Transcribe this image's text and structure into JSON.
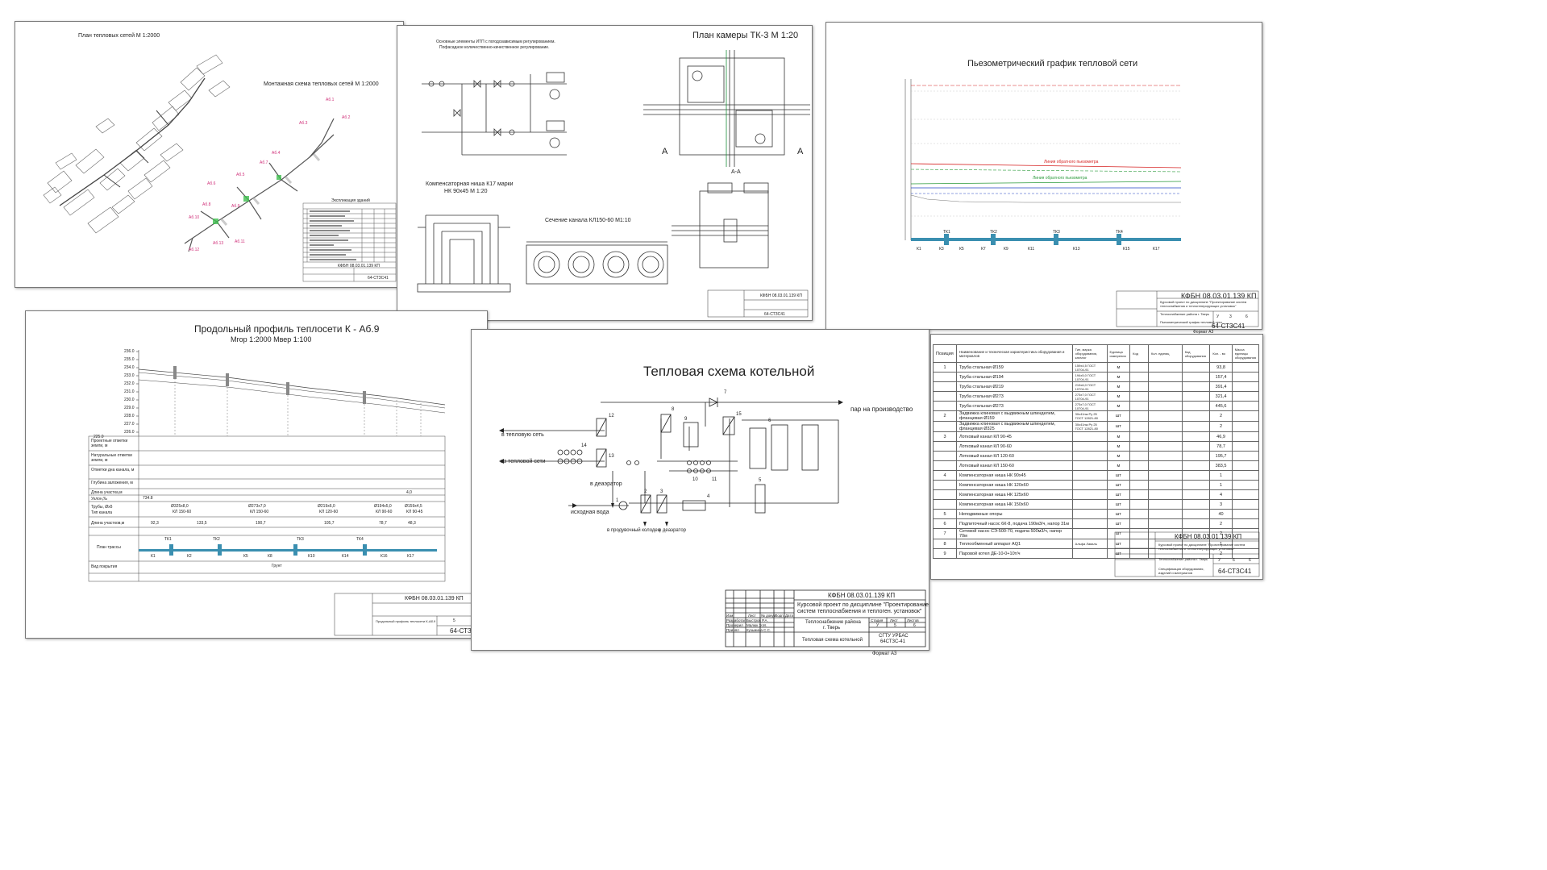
{
  "drawing_code": "КФБН 08.03.01.139 КП",
  "sheet_code": "64-СТЗС41",
  "sheet1": {
    "title_plan": "План тепловых сетей М 1:2000",
    "title_montage": "Монтажная схема тепловых сетей М 1:2000",
    "legend_title": "Экспликация зданий",
    "node_labels": [
      "Аб.1",
      "Аб.2",
      "Аб.3",
      "Аб.4",
      "Аб.5",
      "Аб.6",
      "Аб.7",
      "Аб.8",
      "Аб.9",
      "Аб.10",
      "Аб.11",
      "Аб.12",
      "Аб.13"
    ]
  },
  "sheet2": {
    "title_itp": "Основные элементы ИТП с погодозависимым регулированием.",
    "title_itp2": "Пофасадное количественно-качественное регулирование.",
    "title_niche": "Компенсаторная ниша К17 марки",
    "title_niche2": "НК 90х45 М 1:20",
    "title_channel": "Сечение канала КЛ150-60 М1:10",
    "title_chamber": "План камеры ТК-3 М 1:20",
    "section_label": "А-А",
    "cut_letter": "А",
    "stamp_code": "КФБН 08.03.01.139 КП",
    "stamp_sheet": "64-СТЗС41"
  },
  "sheet3": {
    "title": "Пьезометрический график тепловой сети",
    "line_return": "Линия обратного пьезометра",
    "line_supply": "Линия обратного пьезометра",
    "nodes": [
      "ТК1",
      "ТК2",
      "ТК3",
      "ТК4"
    ],
    "k_labels": [
      "К1",
      "К2",
      "К3",
      "К4",
      "К5",
      "К6",
      "К7",
      "К8",
      "К9",
      "К10",
      "К11",
      "К12",
      "К13",
      "К14",
      "К15",
      "К16",
      "К17"
    ],
    "stamp_code": "КФБН 08.03.01.139 КП",
    "stamp_project": "Курсовой проект по дисциплине \"Проектирование систем теплоснабжения и теплогенерирующих установок\"",
    "stamp_city": "Теплоснабжение района г. Тверь",
    "stamp_sheet": "64-СТЗС41",
    "stamp_format": "Формат А3",
    "stamp_sheetno": "3",
    "stamp_sheets": "6",
    "stamp_letter": "У",
    "stamp_caption": "Пьезометрический график тепловой сети"
  },
  "sheet4": {
    "title": "Продольный профиль теплосети К - Аб.9",
    "scale": "Мгор 1:2000   Мвер 1:100",
    "y_ticks": [
      "236.0",
      "235.0",
      "234.0",
      "233.0",
      "232.0",
      "231.0",
      "230.0",
      "229.0",
      "228.0",
      "227.0",
      "226.0"
    ],
    "y_bottom": "225.0",
    "rows": [
      "Проектные отметки земли, м",
      "Натуральные отметки земли, м",
      "Отметки дна канала, м",
      "Глубина заложения, м",
      "Длина участка,м",
      "Уклон,‰",
      "Трубы, Øxδ",
      "Тип канала",
      "Длина участков,м",
      "План трассы",
      "Вид покрытия"
    ],
    "slope_left": "734.8",
    "slope_right": "4,0",
    "pipes": [
      "Ø325х8,0",
      "Ø273х7,0",
      "Ø219х6,0",
      "Ø194х5,0",
      "Ø159х4,5"
    ],
    "channels": [
      "КЛ 150-60",
      "КЛ 150-60",
      "КЛ 120-60",
      "КЛ 90-60",
      "КЛ 90-45"
    ],
    "lengths": [
      "92,3",
      "133,5",
      "190,7",
      "105,7",
      "78,7",
      "48,3"
    ],
    "tk_labels": [
      "ТК1",
      "ТК2",
      "ТК3",
      "ТК4"
    ],
    "k_labels": [
      "К1",
      "К2",
      "К3",
      "К4",
      "К5",
      "К6",
      "К7",
      "К8",
      "К9",
      "К10",
      "К11",
      "К12",
      "К13",
      "К14",
      "К15",
      "К16",
      "К17"
    ],
    "cover": "Грунт",
    "stamp_code": "КФБН 08.03.01.139 КП",
    "stamp_sheet": "64-СТЗ",
    "stamp_caption": "Продольный профиль теплосети К-Аб.9",
    "stamp_sheetno": "5",
    "stamp_sheets": "6"
  },
  "sheet5": {
    "title": "Тепловая схема котельной",
    "label_production": "пар на производство",
    "label_to_network": "в тепловую сеть",
    "label_from_network": "из тепловой сети",
    "label_deaerator1": "в деаэратор",
    "label_source_water": "исходная вода",
    "label_drain": "в продувочный колодец",
    "label_deaerator2": "в деаэратор",
    "numbers": [
      "1",
      "2",
      "3",
      "4",
      "5",
      "6",
      "7",
      "8",
      "9",
      "10",
      "11",
      "12",
      "13",
      "14",
      "15"
    ],
    "stamp": {
      "code": "КФБН 08.03.01.139 КП",
      "project": "Курсовой проект по дисциплине \"Проектирование",
      "project2": "систем теплоснабжения и теплоген. установок\"",
      "city": "Теплоснабжение района",
      "city2": "г. Тверь",
      "caption": "Тепловая схема котельной",
      "stage_h": "Стадия",
      "sheet_h": "Лист",
      "sheets_h": "Листов",
      "stage": "У",
      "sheet": "5",
      "sheets": "6",
      "org": "СГТУ УРБАС",
      "org2": "64СТЗС-41",
      "format": "Формат А3",
      "hdr_izm": "Изм",
      "hdr_list": "Лист",
      "hdr_doc": "№ докум.",
      "hdr_sign": "Подп.",
      "hdr_date": "Дата",
      "role_dev": "Разработал",
      "name_dev": "Быстров Р.А.",
      "role_check": "Проверил",
      "name_check": "Малюк Э.М.",
      "role_accept": "Принял",
      "name_accept": "Кузьмина С.С."
    }
  },
  "sheet6": {
    "col_pos": "Позиция",
    "col_name": "Наименование и техническая характеристика оборудования и материалов",
    "col_type": "Тип, марка оборудования, каталог",
    "col_unit": "Единица измерения",
    "col_code": "Код",
    "col_count": "Кол. единиц",
    "col_material": "Код оборудования",
    "col_qty": "Кол. - во",
    "col_mass": "Масса единицы оборудования",
    "rows": [
      {
        "pos": "1",
        "name": "Труба стальная Ø159",
        "type": "159х4,5 ГОСТ 10704-91",
        "unit": "м",
        "qty": "93,8"
      },
      {
        "pos": "",
        "name": "Труба стальная Ø194",
        "type": "194х5,0 ГОСТ 10704-91",
        "unit": "м",
        "qty": "157,4"
      },
      {
        "pos": "",
        "name": "Труба стальная Ø219",
        "type": "219х6,0 ГОСТ 10704-91",
        "unit": "м",
        "qty": "391,4"
      },
      {
        "pos": "",
        "name": "Труба стальная Ø273",
        "type": "273х7,0 ГОСТ 10704-91",
        "unit": "м",
        "qty": "321,4"
      },
      {
        "pos": "",
        "name": "Труба стальная Ø273",
        "type": "273х7,0 ГОСТ 10704-91",
        "unit": "м",
        "qty": "445,6"
      },
      {
        "pos": "2",
        "name": "Задвижка клиновая с выдвижным шпинделем, фланцевая Ø159",
        "type": "30с41нж Ру 25 ГОСТ 12821-80",
        "unit": "шт",
        "qty": "2"
      },
      {
        "pos": "",
        "name": "Задвижка клиновая с выдвижным шпинделем, фланцевая Ø325",
        "type": "30с41нж Ру 25 ГОСТ 12821-80",
        "unit": "шт",
        "qty": "2"
      },
      {
        "pos": "3",
        "name": "Лотковый канал КЛ 90-45",
        "type": "",
        "unit": "м",
        "qty": "46,9"
      },
      {
        "pos": "",
        "name": "Лотковый канал КЛ 90-60",
        "type": "",
        "unit": "м",
        "qty": "78,7"
      },
      {
        "pos": "",
        "name": "Лотковый канал КЛ 120-60",
        "type": "",
        "unit": "м",
        "qty": "195,7"
      },
      {
        "pos": "",
        "name": "Лотковый канал КЛ 150-60",
        "type": "",
        "unit": "м",
        "qty": "383,5"
      },
      {
        "pos": "4",
        "name": "Компенсаторная ниша НК 90х45",
        "type": "",
        "unit": "шт",
        "qty": "1"
      },
      {
        "pos": "",
        "name": "Компенсаторная ниша НК 120х60",
        "type": "",
        "unit": "шт",
        "qty": "1"
      },
      {
        "pos": "",
        "name": "Компенсаторная ниша НК 125х60",
        "type": "",
        "unit": "шт",
        "qty": "4"
      },
      {
        "pos": "",
        "name": "Компенсаторная ниша НК 150х60",
        "type": "",
        "unit": "шт",
        "qty": "3"
      },
      {
        "pos": "5",
        "name": "Неподвижные опоры",
        "type": "",
        "unit": "шт",
        "qty": "40"
      },
      {
        "pos": "6",
        "name": "Подпиточный насос 6К-8, подача 190м3/ч, напор 31м",
        "type": "",
        "unit": "шт",
        "qty": "2"
      },
      {
        "pos": "7",
        "name": "Сетевой насос СЭ-500-70, подача 500м3/ч, напор 70м",
        "type": "",
        "unit": "шт",
        "qty": "2"
      },
      {
        "pos": "8",
        "name": "Теплообменный аппарат АQ1",
        "type": "Альфа Лаваль",
        "unit": "шт",
        "qty": "1"
      },
      {
        "pos": "9",
        "name": "Паровой котел ДЕ-10-0+10т/ч",
        "type": "",
        "unit": "шт",
        "qty": "2"
      }
    ],
    "stamp_code": "КФБН 08.03.01.139 КП",
    "stamp_project": "Курсовой проект по дисциплине \"Проектирование систем теплоснабжения и теплогенерирующих установок\"",
    "stamp_city": "Теплоснабжение района г. Тверь",
    "stamp_caption": "Спецификация оборудования, изделий и материалов",
    "stamp_sheet": "64-СТЗС41",
    "stamp_sheetno": "6",
    "stamp_sheets": "6",
    "stamp_letter": "У"
  },
  "colors": {
    "pink": "#d0307a",
    "red_line": "#d62020",
    "green_line": "#2a9a3a",
    "blue_line": "#2040c0",
    "pipe_blue": "#3a8fb0",
    "highlight_green": "#3fbf4f"
  }
}
